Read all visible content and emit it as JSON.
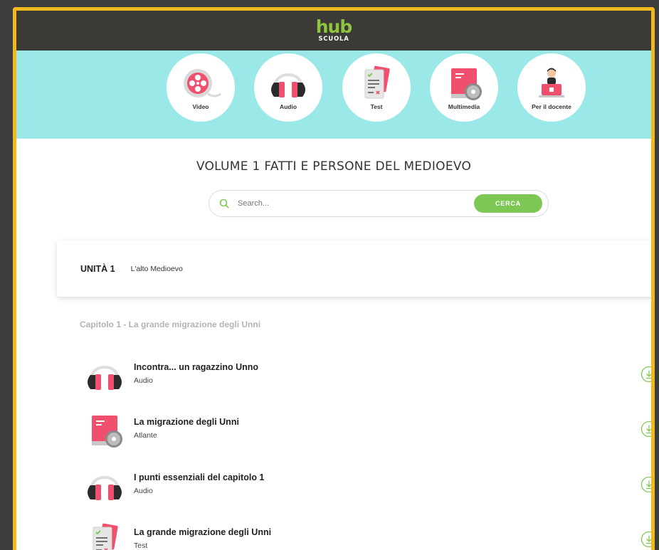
{
  "header": {
    "logo_top": "hub",
    "logo_bottom": "SCUOLA"
  },
  "categories": [
    {
      "label": "Video",
      "icon": "film-reel-icon"
    },
    {
      "label": "Audio",
      "icon": "headphones-icon"
    },
    {
      "label": "Test",
      "icon": "test-sheet-icon"
    },
    {
      "label": "Multimedia",
      "icon": "book-cd-icon"
    },
    {
      "label": "Per il docente",
      "icon": "teacher-laptop-icon"
    }
  ],
  "page_title": "VOLUME 1 FATTI E PERSONE DEL MEDIOEVO",
  "search": {
    "placeholder": "Search...",
    "button_label": "CERCA"
  },
  "unit": {
    "number": "UNITÀ 1",
    "name": "L'alto Medioevo"
  },
  "chapter_title": "Capitolo 1 - La grande migrazione degli Unni",
  "resources": [
    {
      "title": "Incontra... un ragazzino Unno",
      "type": "Audio",
      "icon": "headphones-icon"
    },
    {
      "title": "La migrazione degli Unni",
      "type": "Atlante",
      "icon": "book-cd-icon"
    },
    {
      "title": "I punti essenziali del capitolo 1",
      "type": "Audio",
      "icon": "headphones-icon"
    },
    {
      "title": "La grande migrazione degli Unni",
      "type": "Test",
      "icon": "test-sheet-icon"
    }
  ],
  "colors": {
    "accent_green": "#7dc855",
    "category_bar": "#9be8e8",
    "header": "#3b3a37",
    "frame": "#f2b91d",
    "icon_red": "#f0506e"
  }
}
